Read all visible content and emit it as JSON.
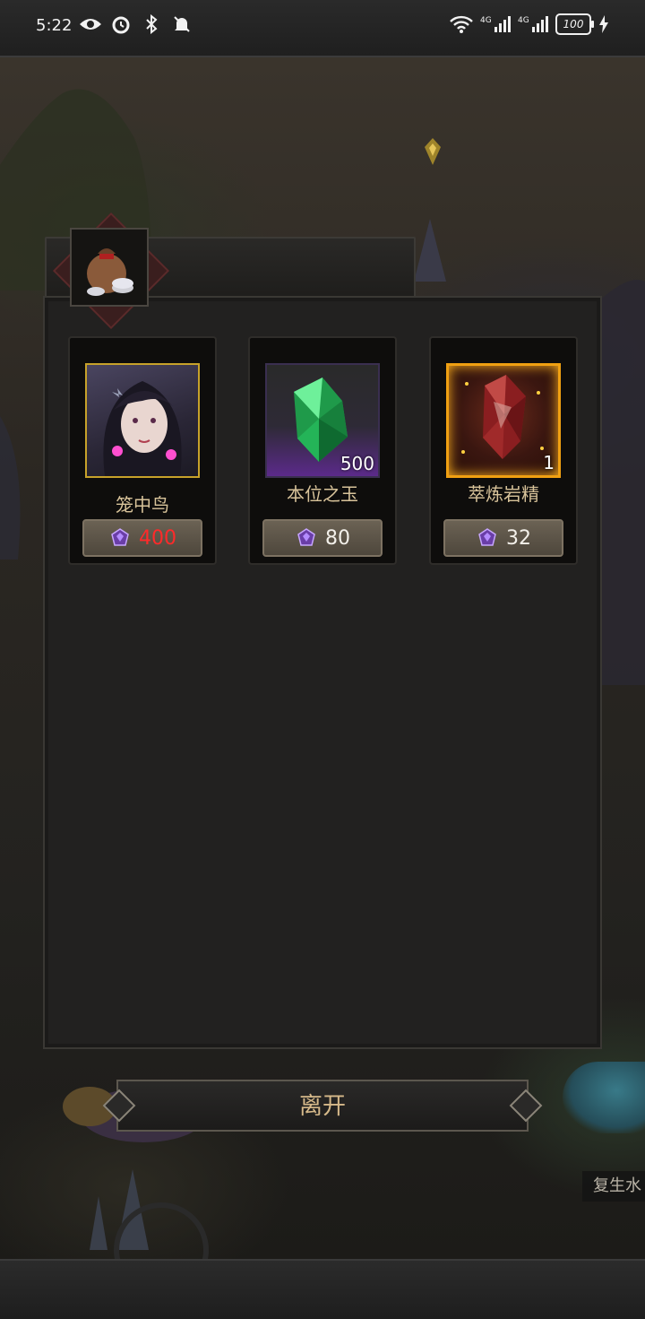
{
  "status_bar": {
    "time": "5:22",
    "left_icons": [
      "eye-icon",
      "alarm-icon",
      "bluetooth-icon",
      "mute-bell-icon"
    ],
    "right_icons": [
      "wifi-icon",
      "signal-4g-icon",
      "signal-4g-icon",
      "battery-icon",
      "charging-icon"
    ],
    "network_1": "4G",
    "network_2": "4G",
    "battery": "100"
  },
  "shop": {
    "tab_icon": "loot-bag-icon",
    "items": [
      {
        "name": "笼中鸟",
        "quantity": "",
        "price": "400",
        "price_color": "#ff2a2a",
        "currency_icon": "purple-gem-icon",
        "frame": "gold"
      },
      {
        "name": "本位之玉",
        "quantity": "500",
        "price": "80",
        "price_color": "#f3f0ea",
        "currency_icon": "purple-gem-icon",
        "frame": "purple"
      },
      {
        "name": "萃炼岩精",
        "quantity": "1",
        "price": "32",
        "price_color": "#f3f0ea",
        "currency_icon": "purple-gem-icon",
        "frame": "orange"
      }
    ],
    "leave_label": "离开"
  },
  "background": {
    "side_label": "复生水"
  }
}
